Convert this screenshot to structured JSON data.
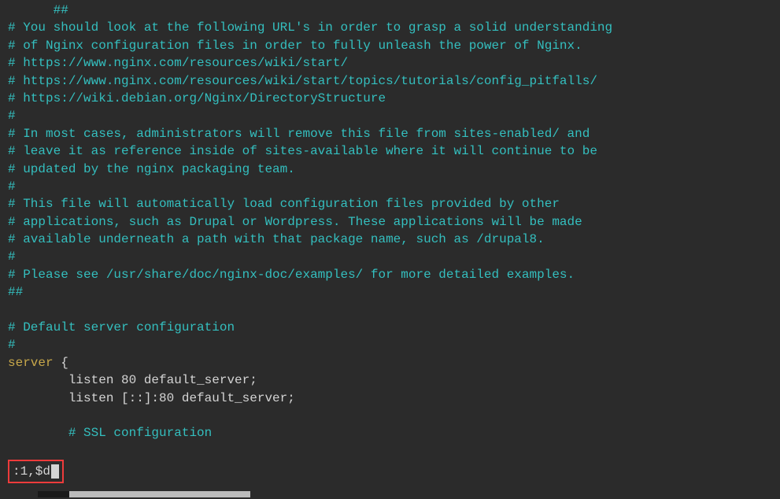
{
  "lines": [
    {
      "indent": "      ",
      "class": "comment",
      "text": "##"
    },
    {
      "indent": "",
      "class": "comment",
      "text": "# You should look at the following URL's in order to grasp a solid understanding"
    },
    {
      "indent": "",
      "class": "comment",
      "text": "# of Nginx configuration files in order to fully unleash the power of Nginx."
    },
    {
      "indent": "",
      "class": "comment",
      "text": "# https://www.nginx.com/resources/wiki/start/"
    },
    {
      "indent": "",
      "class": "comment",
      "text": "# https://www.nginx.com/resources/wiki/start/topics/tutorials/config_pitfalls/"
    },
    {
      "indent": "",
      "class": "comment",
      "text": "# https://wiki.debian.org/Nginx/DirectoryStructure"
    },
    {
      "indent": "",
      "class": "comment",
      "text": "#"
    },
    {
      "indent": "",
      "class": "comment",
      "text": "# In most cases, administrators will remove this file from sites-enabled/ and"
    },
    {
      "indent": "",
      "class": "comment",
      "text": "# leave it as reference inside of sites-available where it will continue to be"
    },
    {
      "indent": "",
      "class": "comment",
      "text": "# updated by the nginx packaging team."
    },
    {
      "indent": "",
      "class": "comment",
      "text": "#"
    },
    {
      "indent": "",
      "class": "comment",
      "text": "# This file will automatically load configuration files provided by other"
    },
    {
      "indent": "",
      "class": "comment",
      "text": "# applications, such as Drupal or Wordpress. These applications will be made"
    },
    {
      "indent": "",
      "class": "comment",
      "text": "# available underneath a path with that package name, such as /drupal8."
    },
    {
      "indent": "",
      "class": "comment",
      "text": "#"
    },
    {
      "indent": "",
      "class": "comment",
      "text": "# Please see /usr/share/doc/nginx-doc/examples/ for more detailed examples."
    },
    {
      "indent": "",
      "class": "comment",
      "text": "##"
    },
    {
      "indent": "",
      "class": "",
      "text": ""
    },
    {
      "indent": "",
      "class": "comment",
      "text": "# Default server configuration"
    },
    {
      "indent": "",
      "class": "comment",
      "text": "#"
    },
    {
      "indent": "",
      "class": "server-line",
      "text": ""
    },
    {
      "indent": "        ",
      "class": "directive",
      "text": "listen 80 default_server;"
    },
    {
      "indent": "        ",
      "class": "directive",
      "text": "listen [::]:80 default_server;"
    },
    {
      "indent": "",
      "class": "",
      "text": ""
    },
    {
      "indent": "        ",
      "class": "comment",
      "text": "# SSL configuration"
    }
  ],
  "server_keyword": "server",
  "server_brace": " {",
  "command": ":1,$d"
}
